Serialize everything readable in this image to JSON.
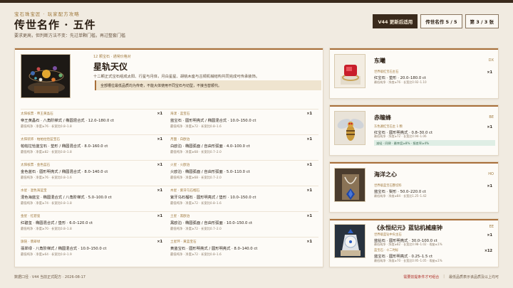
{
  "header": {
    "breadcrumb": "宝石珠宝匠 · 玩家配方攻略",
    "title": "传世名作 · 五件",
    "subtitle": "要求更高，但判断方法不变：先过单颗门槛，再过整套门槛",
    "badges": [
      "V44 更新后适用",
      "传世名作 5 / 5",
      "第 3 / 3 张"
    ]
  },
  "hero": {
    "tag": "12 颗宝石 · 通常价格对",
    "name": "星轨天仪",
    "desc": "十二颗正式宝石组成太阳、行星与月体，月白星星、胡桃木座与古铜机械结构共同完成可传承装饰。",
    "note": "全部槽位最低品质均为传奇，不能大体使用不同宝石与切型，不接当替顺代。"
  },
  "materials": [
    [
      {
        "src": "太阳核票 · 帝王黄晶石",
        "main": "帝王黄晶石 · 八角阶梯式 / 椭圆混合式 · 12.0–180.0 ct",
        "meta": "最低纯净 · 净度≥76 · 长宽比0.8–1.8",
        "qty": "×1"
      },
      {
        "src": "海漾 · 蓝宝石",
        "main": "蓝宝石 · 圆形明亮式 / 椭圆混合式 · 10.0–150.0 ct",
        "meta": "最低纯净 · 净度≥72 · 长宽比0.8–1.6",
        "qty": "×1"
      }
    ],
    [
      {
        "src": "太阳装饰 · 帕帕拉恰蓝宝石",
        "main": "帕帕拉恰蓝宝石 · 垫形 / 椭圆混合式 · 8.0–160.0 ct",
        "meta": "最低纯净 · 净度≥82 · 长宽比0.8–1.8",
        "qty": "×1"
      },
      {
        "src": "月面 · 白欧泊",
        "main": "白欧泊 · 椭圆弧面 / 自由形弧面 · 4.0–100.0 ct",
        "meta": "最低纯净 · 净度≥68 · 长宽比0.7–2.0",
        "qty": "×1"
      }
    ],
    [
      {
        "src": "太阳核票 · 金色蓝石",
        "main": "金色蓝石 · 圆形明亮式 / 椭圆混合式 · 8.0–140.0 ct",
        "meta": "最低纯净 · 净度≥76 · 长宽比0.8–1.6",
        "qty": "×1"
      },
      {
        "src": "火星 · 火欧泊",
        "main": "火欧泊 · 椭圆弧面 / 自由形弧面 · 5.0–110.0 ct",
        "meta": "最低纯净 · 净度≥68 · 长宽比0.7–2.0",
        "qty": "×1"
      }
    ],
    [
      {
        "src": "水星 · 混色海蓝宝",
        "main": "混色海蓝宝 · 椭圆混合式 / 八角阶梯式 · 5.0–100.0 ct",
        "meta": "最低纯净 · 净度≥74 · 长宽比0.8–1.8",
        "qty": "×1"
      },
      {
        "src": "木星 · 紫牙乌石榴石",
        "main": "紫牙乌石榴石 · 圆形明亮式 / 垫形 · 10.0–150.0 ct",
        "meta": "最低纯净 · 净度≥72 · 长宽比0.8–1.6",
        "qty": "×1"
      }
    ],
    [
      {
        "src": "金星 · 红碧玺",
        "main": "红碧玺 · 椭圆混合式 / 垫形 · 6.0–120.0 ct",
        "meta": "最低纯净 · 净度≥70 · 长宽比0.8–1.8",
        "qty": "×1"
      },
      {
        "src": "土星 · 黑欧泊",
        "main": "黑欧泊 · 椭圆弧面 / 自由形弧面 · 10.0–150.0 ct",
        "meta": "最低纯净 · 净度≥72 · 长宽比0.7–2.0",
        "qty": "×1"
      }
    ],
    [
      {
        "src": "旗链 · 翡翠绿",
        "main": "翡翠绿 · 八角阶梯式 / 椭圆混合式 · 10.0–150.0 ct",
        "meta": "最低纯净 · 净度≥64 · 长宽比0.8–1.9",
        "qty": "×1"
      },
      {
        "src": "土星环 · 黄蓝宝石",
        "main": "黄蓝宝石 · 圆形明亮式 / 圆形明亮式 · 8.0–140.0 ct",
        "meta": "最低纯净 · 净度≥72 · 长宽比0.8–1.6",
        "qty": "×1"
      }
    ]
  ],
  "side_items": [
    {
      "name": "东曦",
      "code": "DX",
      "lines": [
        {
          "src": "世界级红宝石主石",
          "main": "红宝石 · 垫形 · 20.0–180.0 ct",
          "meta": "最低纯净 · 净度≥76 · 长宽比0.92–1.10",
          "qty": "×1"
        }
      ]
    },
    {
      "name": "赤瞳蜂",
      "code": "BE",
      "lines": [
        {
          "src": "东色遍红宝石主 1 颗",
          "main": "红宝石 · 圆形明亮式 · 0.8–30.0 ct",
          "meta": "最低纯净 · 净度≥72 · 长宽比0.94–1.06",
          "qty": "×1"
        }
      ],
      "highlight": "减轻 · 同律 · 最幸度≥8% · 报差率≥4%"
    },
    {
      "name": "海洋之心",
      "code": "HO",
      "lines": [
        {
          "src": "世界级蓝宝石整切料",
          "main": "蓝宝石 · 梨形 · 50.0–220.0 ct",
          "meta": "最低纯净 · 净度≥84 · 长宽比1.25–1.42",
          "qty": "×1"
        }
      ]
    },
    {
      "name": "《永恒纪元》蓝钻机械座钟",
      "code": "EE",
      "lines": [
        {
          "src": "世界级蓝钻中央主石",
          "main": "蓝钻石 · 圆形明亮式 · 30.0–100.0 ct",
          "meta": "最低纯净 · 净度≥82 · 长宽比0.98–1.02 · 瑕疵≤1%",
          "qty": "×1"
        },
        {
          "src": "蓝宝石 · 十二时标",
          "main": "蓝宝石 · 圆形明亮式 · 0.25–1.5 ct",
          "meta": "最低纯净 · 净度≥70 · 长宽比0.95–1.05 · 瑕疵≤1%",
          "qty": "×12"
        }
      ]
    }
  ],
  "footer": {
    "left": "数据口径 · V44 当前正式配方 · 2026-08-17",
    "right_highlight": "需要前提条件才可组合",
    "right_sep": "|",
    "right": "最低品质表示该品质及以上均可"
  },
  "colors": {
    "accent": "#a86f3a",
    "dark": "#3a2a1c",
    "bg": "#f1ebe1"
  }
}
